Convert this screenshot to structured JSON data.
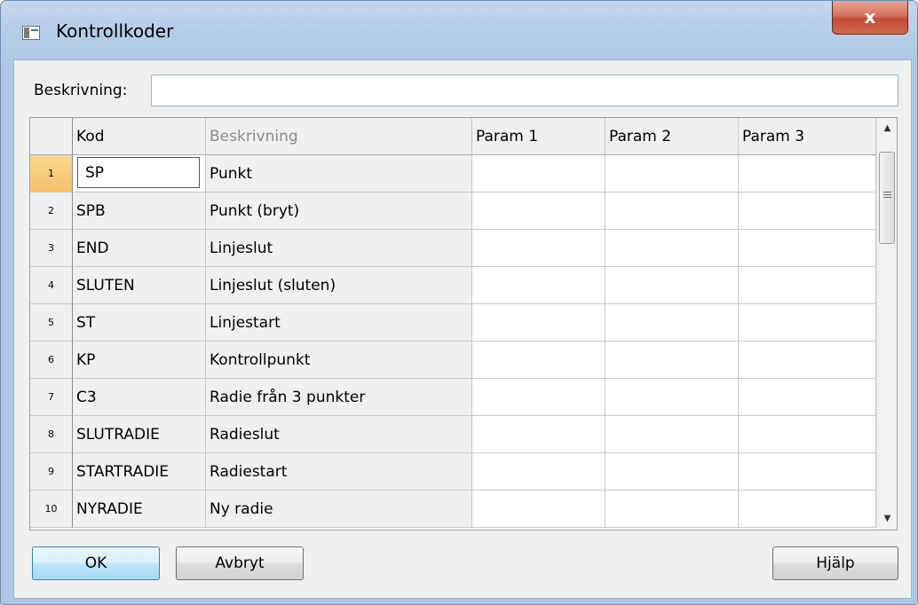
{
  "window": {
    "title": "Kontrollkoder",
    "close_glyph": "x"
  },
  "description": {
    "label": "Beskrivning:",
    "value": "",
    "placeholder": ""
  },
  "table": {
    "columns": [
      "Kod",
      "Beskrivning",
      "Param 1",
      "Param 2",
      "Param 3"
    ],
    "rows": [
      {
        "num": "1",
        "kod": "SP",
        "beskrivning": "Punkt",
        "p1": "",
        "p2": "",
        "p3": ""
      },
      {
        "num": "2",
        "kod": "SPB",
        "beskrivning": "Punkt (bryt)",
        "p1": "",
        "p2": "",
        "p3": ""
      },
      {
        "num": "3",
        "kod": "END",
        "beskrivning": "Linjeslut",
        "p1": "",
        "p2": "",
        "p3": ""
      },
      {
        "num": "4",
        "kod": "SLUTEN",
        "beskrivning": "Linjeslut (sluten)",
        "p1": "",
        "p2": "",
        "p3": ""
      },
      {
        "num": "5",
        "kod": "ST",
        "beskrivning": "Linjestart",
        "p1": "",
        "p2": "",
        "p3": ""
      },
      {
        "num": "6",
        "kod": "KP",
        "beskrivning": "Kontrollpunkt",
        "p1": "",
        "p2": "",
        "p3": ""
      },
      {
        "num": "7",
        "kod": "C3",
        "beskrivning": "Radie från 3 punkter",
        "p1": "",
        "p2": "",
        "p3": ""
      },
      {
        "num": "8",
        "kod": "SLUTRADIE",
        "beskrivning": "Radieslut",
        "p1": "",
        "p2": "",
        "p3": ""
      },
      {
        "num": "9",
        "kod": "STARTRADIE",
        "beskrivning": "Radiestart",
        "p1": "",
        "p2": "",
        "p3": ""
      },
      {
        "num": "10",
        "kod": "NYRADIE",
        "beskrivning": "Ny radie",
        "p1": "",
        "p2": "",
        "p3": ""
      }
    ],
    "active_row": "1"
  },
  "scrollbar": {
    "up_glyph": "▲",
    "down_glyph": "▼"
  },
  "buttons": {
    "ok": "OK",
    "cancel": "Avbryt",
    "help": "Hjälp"
  },
  "colors": {
    "active_row_header": "#f6c069",
    "default_button_border": "#3c7fb1",
    "close_button": "#c14b35"
  }
}
